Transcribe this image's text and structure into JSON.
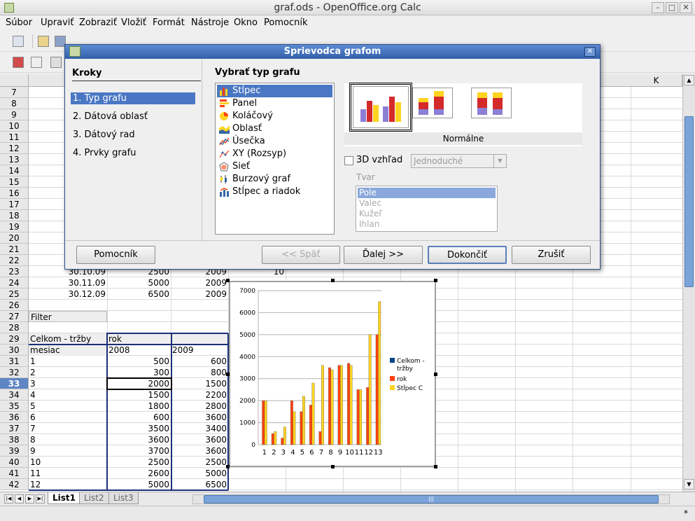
{
  "window": {
    "title": "graf.ods - OpenOffice.org Calc"
  },
  "menu": [
    "Súbor",
    "Upraviť",
    "Zobraziť",
    "Vložiť",
    "Formát",
    "Nástroje",
    "Okno",
    "Pomocník"
  ],
  "columns": [
    "K"
  ],
  "rows": [
    "7",
    "8",
    "9",
    "10",
    "11",
    "12",
    "13",
    "14",
    "15",
    "16",
    "17",
    "18",
    "19",
    "20",
    "21",
    "22",
    "23",
    "24",
    "25",
    "26",
    "27",
    "28",
    "29",
    "30",
    "31",
    "32",
    "33",
    "34",
    "35",
    "36",
    "37",
    "38",
    "39",
    "40",
    "41",
    "42"
  ],
  "active_row": "33",
  "cells": {
    "r23": [
      "30.10.09",
      "2500",
      "2009",
      "10"
    ],
    "r24": [
      "30.11.09",
      "5000",
      "2009"
    ],
    "r25": [
      "30.12.09",
      "6500",
      "2009"
    ],
    "filter": "Filter",
    "pivot_title": "Celkom - tržby",
    "pivot_rok": "rok",
    "pivot_mesiac": "mesiac",
    "year_a": "2008",
    "year_b": "2009",
    "pivot_rows": [
      [
        "1",
        "500",
        "600"
      ],
      [
        "2",
        "300",
        "800"
      ],
      [
        "3",
        "2000",
        "1500"
      ],
      [
        "4",
        "1500",
        "2200"
      ],
      [
        "5",
        "1800",
        "2800"
      ],
      [
        "6",
        "600",
        "3600"
      ],
      [
        "7",
        "3500",
        "3400"
      ],
      [
        "8",
        "3600",
        "3600"
      ],
      [
        "9",
        "3700",
        "3600"
      ],
      [
        "10",
        "2500",
        "2500"
      ],
      [
        "11",
        "2600",
        "5000"
      ],
      [
        "12",
        "5000",
        "6500"
      ]
    ]
  },
  "sheet_tabs": [
    "List1",
    "List2",
    "List3"
  ],
  "status": {
    "modified": "*"
  },
  "dialog": {
    "title": "Sprievodca grafom",
    "steps_header": "Kroky",
    "steps": [
      "1. Typ grafu",
      "2. Dátová oblasť",
      "3. Dátový rad",
      "4. Prvky grafu"
    ],
    "section_title": "Vybrať typ grafu",
    "chart_types": [
      "Stĺpec",
      "Panel",
      "Koláčový",
      "Oblasť",
      "Úsečka",
      "XY (Rozsyp)",
      "Sieť",
      "Burzový graf",
      "Stĺpec a riadok"
    ],
    "variant_label": "Normálne",
    "checkbox_3d": "3D vzhľad",
    "combo_3d": "Jednoduché",
    "shape_label": "Tvar",
    "shapes": [
      "Pole",
      "Valec",
      "Kužeľ",
      "Ihlan"
    ],
    "buttons": {
      "help": "Pomocník",
      "back": "<< Späť",
      "next": "Ďalej >>",
      "finish": "Dokončiť",
      "cancel": "Zrušiť"
    }
  },
  "chart_data": {
    "type": "bar",
    "categories": [
      "1",
      "2",
      "3",
      "4",
      "5",
      "6",
      "7",
      "8",
      "9",
      "10",
      "11",
      "12",
      "13"
    ],
    "series": [
      {
        "name": "Celkom - tržby",
        "values": [
          0,
          0,
          0,
          0,
          0,
          0,
          0,
          0,
          0,
          0,
          0,
          0,
          0
        ]
      },
      {
        "name": "rok",
        "values": [
          2000,
          500,
          300,
          2000,
          1500,
          1800,
          600,
          3500,
          3600,
          3700,
          2500,
          2600,
          5000
        ]
      },
      {
        "name": "Stĺpec C",
        "values": [
          2000,
          600,
          800,
          1500,
          2200,
          2800,
          3600,
          3400,
          3600,
          3600,
          2500,
          5000,
          6500
        ]
      }
    ],
    "yticks": [
      "0",
      "1000",
      "2000",
      "3000",
      "4000",
      "5000",
      "6000",
      "7000"
    ],
    "ylim": [
      0,
      7000
    ],
    "legend": [
      "Celkom - tržby",
      "rok",
      "Stĺpec C"
    ],
    "colors": [
      "#004586",
      "#ff420e",
      "#ffd320"
    ],
    "legend_position": "right",
    "grid": true
  }
}
